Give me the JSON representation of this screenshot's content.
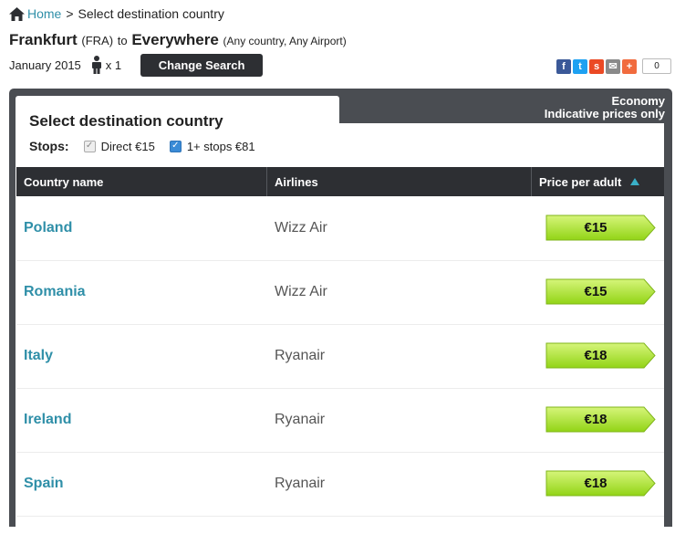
{
  "breadcrumb": {
    "home": "Home",
    "separator": ">",
    "current": "Select destination country"
  },
  "route": {
    "origin": "Frankfurt",
    "origin_code": "(FRA)",
    "to": "to",
    "destination": "Everywhere",
    "destination_detail": "(Any country, Any Airport)"
  },
  "meta": {
    "date": "January 2015",
    "passengers": "x 1",
    "change_search": "Change Search"
  },
  "share": {
    "count": "0",
    "icons": [
      "facebook-icon",
      "twitter-icon",
      "stumbleupon-icon",
      "email-icon",
      "more-icon"
    ]
  },
  "panel": {
    "tab_title": "Select destination country",
    "cabin": "Economy",
    "cabin_note": "Indicative prices only"
  },
  "stops": {
    "label": "Stops:",
    "options": [
      {
        "label": "Direct €15",
        "checked": true,
        "disabled": true
      },
      {
        "label": "1+ stops €81",
        "checked": true,
        "disabled": false
      }
    ]
  },
  "table": {
    "headers": {
      "country": "Country name",
      "airlines": "Airlines",
      "price": "Price per adult"
    },
    "rows": [
      {
        "country": "Poland",
        "airline": "Wizz Air",
        "price": "€15"
      },
      {
        "country": "Romania",
        "airline": "Wizz Air",
        "price": "€15"
      },
      {
        "country": "Italy",
        "airline": "Ryanair",
        "price": "€18"
      },
      {
        "country": "Ireland",
        "airline": "Ryanair",
        "price": "€18"
      },
      {
        "country": "Spain",
        "airline": "Ryanair",
        "price": "€18"
      }
    ]
  },
  "colors": {
    "link": "#2f8fa8",
    "dark": "#2d2f33",
    "price_green": "#a6e23a"
  }
}
